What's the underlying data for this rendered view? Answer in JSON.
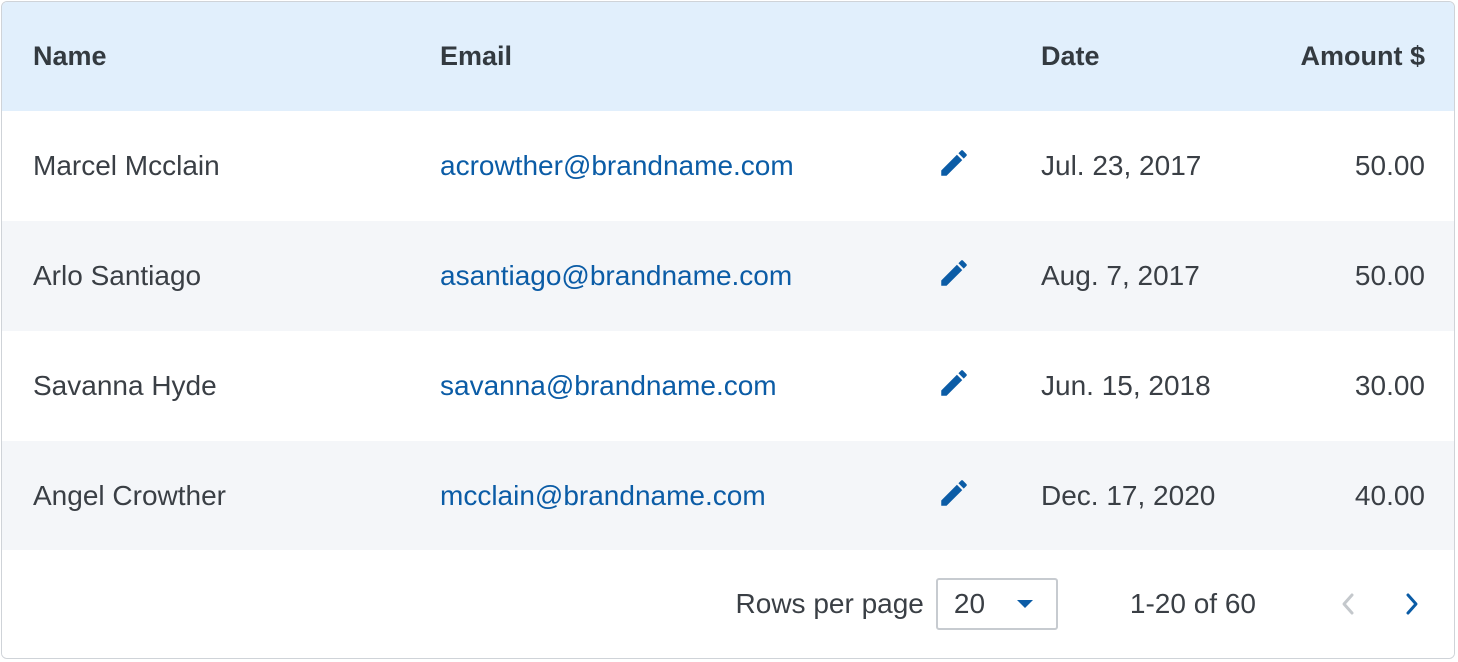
{
  "colors": {
    "header_bg": "#e1effc",
    "link": "#0b5ca6",
    "stripe_bg": "#f4f6f9",
    "disabled": "#c4c8cc"
  },
  "table": {
    "columns": {
      "name": "Name",
      "email": "Email",
      "date": "Date",
      "amount": "Amount $"
    },
    "rows": [
      {
        "name": "Marcel Mcclain",
        "email": "acrowther@brandname.com",
        "date": "Jul. 23, 2017",
        "amount": "50.00",
        "edit_icon": "pencil-icon"
      },
      {
        "name": "Arlo Santiago",
        "email": "asantiago@brandname.com",
        "date": "Aug. 7, 2017",
        "amount": "50.00",
        "edit_icon": "pencil-icon"
      },
      {
        "name": "Savanna Hyde",
        "email": "savanna@brandname.com",
        "date": "Jun. 15, 2018",
        "amount": "30.00",
        "edit_icon": "pencil-icon"
      },
      {
        "name": "Angel Crowther",
        "email": "mcclain@brandname.com",
        "date": "Dec. 17, 2020",
        "amount": "40.00",
        "edit_icon": "pencil-icon"
      }
    ]
  },
  "pagination": {
    "rows_per_page_label": "Rows per page",
    "rows_per_page_value": "20",
    "range_text": "1-20 of 60",
    "prev_icon": "chevron-left-icon",
    "next_icon": "chevron-right-icon",
    "prev_disabled": true
  }
}
